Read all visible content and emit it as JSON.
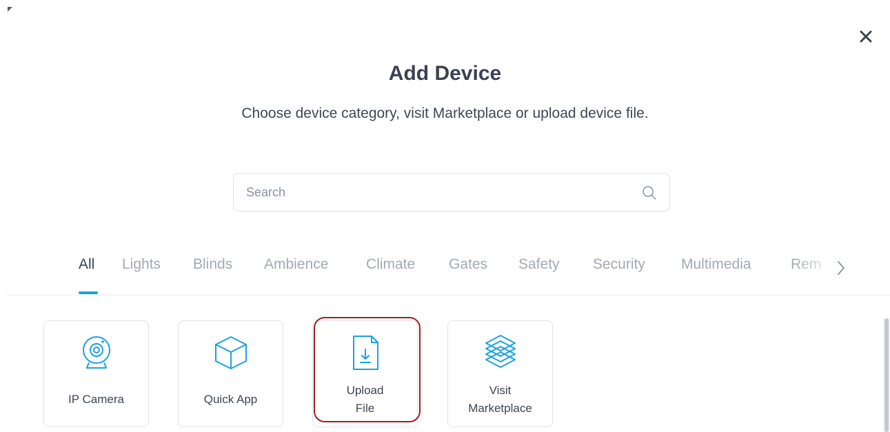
{
  "dialog": {
    "title": "Add Device",
    "subtitle": "Choose device category, visit Marketplace or upload device file.",
    "close_icon": "close-icon"
  },
  "search": {
    "placeholder": "Search",
    "value": "",
    "icon": "search-icon"
  },
  "tabs": [
    {
      "label": "All",
      "active": true
    },
    {
      "label": "Lights",
      "active": false
    },
    {
      "label": "Blinds",
      "active": false
    },
    {
      "label": "Ambience",
      "active": false
    },
    {
      "label": "Climate",
      "active": false
    },
    {
      "label": "Gates",
      "active": false
    },
    {
      "label": "Safety",
      "active": false
    },
    {
      "label": "Security",
      "active": false
    },
    {
      "label": "Multimedia",
      "active": false
    },
    {
      "label": "Rem",
      "active": false
    }
  ],
  "tabs_next_icon": "chevron-right-icon",
  "cards": [
    {
      "label": "IP Camera",
      "icon": "webcam-icon"
    },
    {
      "label": "Quick App",
      "icon": "cube-icon"
    },
    {
      "label_line1": "Upload",
      "label_line2": "File",
      "icon": "file-download-icon",
      "highlighted": true
    },
    {
      "label_line1": "Visit",
      "label_line2": "Marketplace",
      "icon": "layers-icon"
    }
  ],
  "colors": {
    "accent": "#1ba1e2",
    "highlight": "#a11d21",
    "text": "#3d4450",
    "muted_text": "#a3a9b2"
  }
}
